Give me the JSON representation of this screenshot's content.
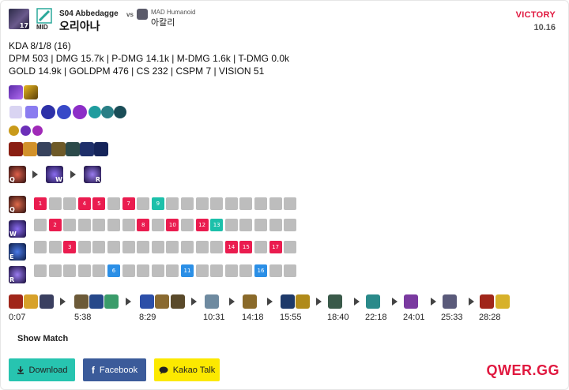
{
  "player": {
    "level": "17",
    "role": "MID",
    "name": "S04 Abbedagge",
    "champion": "오리아나"
  },
  "opponent": {
    "vs": "vs",
    "name": "MAD Humanoid",
    "champion": "아칼리"
  },
  "result": {
    "outcome": "VICTORY",
    "patch": "10.16"
  },
  "stats": {
    "line1": "KDA 8/1/8 (16)",
    "line2": "DPM 503 | DMG 15.7k | P-DMG 14.1k | M-DMG 1.6k | T-DMG 0.0k",
    "line3": "GOLD 14.9k | GOLDPM 476 | CS 232 | CSPM 7 | VISION 51"
  },
  "skill_order": {
    "labels": [
      "Q",
      "W",
      "R"
    ]
  },
  "skill_grid": {
    "rows": [
      {
        "key": "Q",
        "levels": [
          1,
          4,
          5,
          7,
          9
        ]
      },
      {
        "key": "W",
        "levels": [
          2,
          8,
          10,
          12,
          13
        ]
      },
      {
        "key": "E",
        "levels": [
          3,
          14,
          15,
          17
        ]
      },
      {
        "key": "R",
        "levels": [
          6,
          11,
          16
        ]
      }
    ],
    "colors": {
      "Q": "#ea1c4f",
      "W": "#ea1c4f",
      "E": "#ea1c4f",
      "R": "#2b8fe6",
      "teal": "#1cc0aa",
      "empty": "#bdbdbd"
    },
    "row_labels": [
      "Q",
      "W",
      "E",
      "R"
    ]
  },
  "build": {
    "times": [
      "0:07",
      "5:38",
      "8:29",
      "10:31",
      "14:18",
      "15:55",
      "18:40",
      "22:18",
      "24:01",
      "25:33",
      "28:28"
    ]
  },
  "actions": {
    "show_match": "Show Match",
    "download": "Download",
    "facebook": "Facebook",
    "kakao": "Kakao Talk"
  },
  "brand": "QWER.GG",
  "colors": {
    "accent": "#e0183f",
    "download": "#27c4b0",
    "facebook": "#3b5b9a",
    "kakao": "#fce900"
  }
}
